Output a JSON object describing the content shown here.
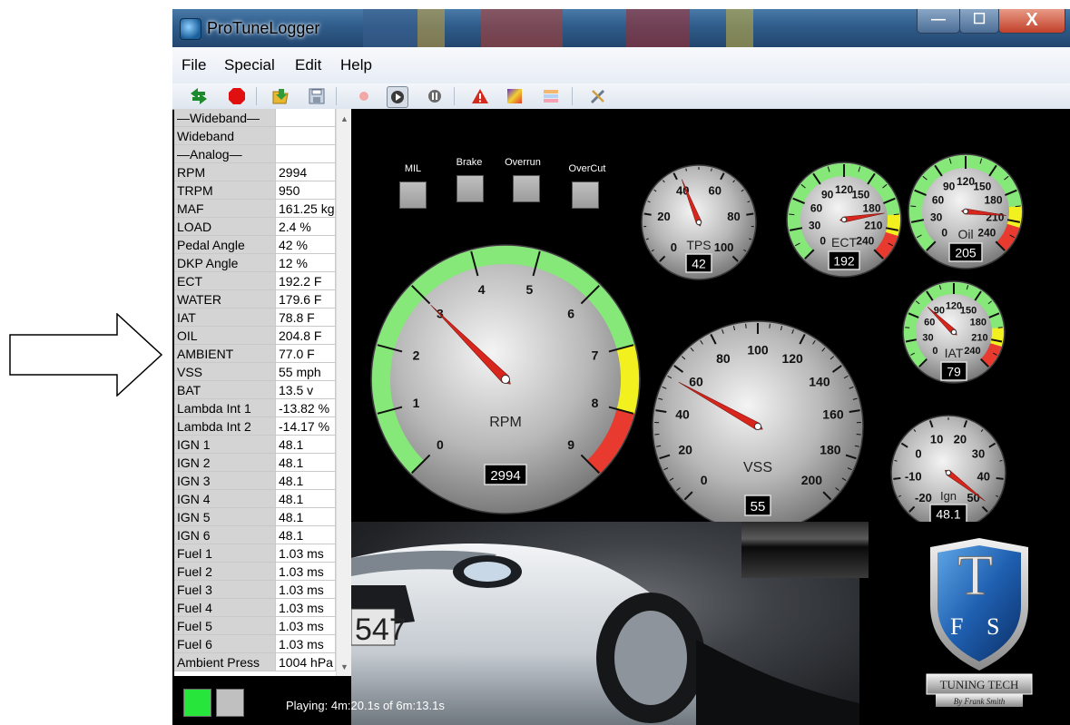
{
  "window": {
    "title": "ProTuneLogger",
    "minimize_glyph": "—",
    "maximize_glyph": "☐",
    "close_glyph": "X"
  },
  "menu": [
    "File",
    "Special",
    "Edit",
    "Help"
  ],
  "toolbar": {
    "icons": [
      "connect-arrows-icon",
      "stop-record-icon",
      "open-file-icon",
      "save-icon",
      "record-icon",
      "play-icon",
      "pause-icon",
      "warning-icon",
      "chart-icon",
      "layers-icon",
      "tools-icon"
    ],
    "selected": "play-icon"
  },
  "signals": [
    {
      "name": "—Wideband—",
      "value": ""
    },
    {
      "name": "Wideband",
      "value": ""
    },
    {
      "name": "—Analog—",
      "value": ""
    },
    {
      "name": "RPM",
      "value": "2994"
    },
    {
      "name": "TRPM",
      "value": "950"
    },
    {
      "name": "MAF",
      "value": "161.25 kg"
    },
    {
      "name": "LOAD",
      "value": "2.4 %"
    },
    {
      "name": "Pedal Angle",
      "value": "42 %"
    },
    {
      "name": "DKP Angle",
      "value": "12 %"
    },
    {
      "name": "ECT",
      "value": "192.2 F"
    },
    {
      "name": "WATER",
      "value": "179.6 F"
    },
    {
      "name": "IAT",
      "value": "78.8 F"
    },
    {
      "name": "OIL",
      "value": "204.8 F"
    },
    {
      "name": "AMBIENT",
      "value": "77.0 F"
    },
    {
      "name": "VSS",
      "value": "55 mph"
    },
    {
      "name": "BAT",
      "value": "13.5 v"
    },
    {
      "name": "Lambda Int 1",
      "value": "-13.82 %"
    },
    {
      "name": "Lambda Int 2",
      "value": "-14.17 %"
    },
    {
      "name": "IGN 1",
      "value": "48.1"
    },
    {
      "name": "IGN 2",
      "value": "48.1"
    },
    {
      "name": "IGN 3",
      "value": "48.1"
    },
    {
      "name": "IGN 4",
      "value": "48.1"
    },
    {
      "name": "IGN 5",
      "value": "48.1"
    },
    {
      "name": "IGN 6",
      "value": "48.1"
    },
    {
      "name": "Fuel 1",
      "value": "1.03 ms"
    },
    {
      "name": "Fuel 2",
      "value": "1.03 ms"
    },
    {
      "name": "Fuel 3",
      "value": "1.03 ms"
    },
    {
      "name": "Fuel 4",
      "value": "1.03 ms"
    },
    {
      "name": "Fuel 5",
      "value": "1.03 ms"
    },
    {
      "name": "Fuel 6",
      "value": "1.03 ms"
    },
    {
      "name": "Ambient Press",
      "value": "1004 hPa"
    }
  ],
  "lamps": [
    "MIL",
    "Brake",
    "Overrun",
    "OverCut"
  ],
  "gauges": {
    "rpm": {
      "label": "RPM",
      "display": "2994",
      "ticks": [
        "0",
        "1",
        "2",
        "3",
        "4",
        "5",
        "6",
        "7",
        "8",
        "9"
      ],
      "min": 0,
      "max": 9,
      "value": 2.994,
      "yellow_from": 7,
      "red_from": 8
    },
    "vss": {
      "label": "VSS",
      "display": "55",
      "ticks": [
        "0",
        "20",
        "40",
        "60",
        "80",
        "100",
        "120",
        "140",
        "160",
        "180",
        "200"
      ],
      "min": 0,
      "max": 200,
      "value": 55
    },
    "tps": {
      "label": "TPS",
      "display": "42",
      "ticks": [
        "0",
        "20",
        "40",
        "60",
        "80",
        "100"
      ],
      "min": 0,
      "max": 100,
      "value": 42
    },
    "ect": {
      "label": "ECT",
      "display": "192",
      "ticks": [
        "0",
        "30",
        "60",
        "90",
        "120",
        "150",
        "180",
        "210",
        "240"
      ],
      "min": 0,
      "max": 240,
      "value": 192,
      "yellow_from": 195,
      "red_from": 215
    },
    "oil": {
      "label": "Oil",
      "display": "205",
      "ticks": [
        "0",
        "30",
        "60",
        "90",
        "120",
        "150",
        "180",
        "210",
        "240"
      ],
      "min": 0,
      "max": 240,
      "value": 205,
      "yellow_from": 195,
      "red_from": 215
    },
    "iat": {
      "label": "IAT",
      "display": "79",
      "ticks": [
        "0",
        "30",
        "60",
        "90",
        "120",
        "150",
        "180",
        "210",
        "240"
      ],
      "min": 0,
      "max": 240,
      "value": 79,
      "yellow_from": 195,
      "red_from": 215
    },
    "ign": {
      "label": "Ign",
      "display": "48.1",
      "ticks": [
        "-20",
        "-10",
        "0",
        "10",
        "20",
        "30",
        "40",
        "50"
      ],
      "min": -20,
      "max": 50,
      "value": 48.1
    }
  },
  "car_plate_text": "547",
  "logo": {
    "letters": [
      "T",
      "F",
      "S"
    ],
    "brand": "TUNING TECH",
    "byline": "By Frank Smith"
  },
  "status": {
    "text": "Playing: 4m:20.1s of 6m:13.1s",
    "indicator_active_color": "#27e53a",
    "indicator_inactive_color": "#c0c0c0"
  },
  "colors": {
    "arc_green": "#86e879",
    "arc_yellow": "#f3f020",
    "arc_red": "#e83a2e",
    "needle": "#d8261c"
  }
}
